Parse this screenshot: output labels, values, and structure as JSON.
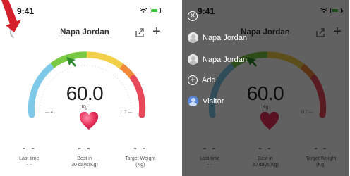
{
  "status_bar": {
    "time": "9:41"
  },
  "header": {
    "user_name": "Napa Jordan"
  },
  "gauge": {
    "weight": "60.0",
    "unit": "Kg",
    "tick_left": "41",
    "tick_right": "117"
  },
  "stats": [
    {
      "value": "- -",
      "label": "Last time",
      "sub": "- -"
    },
    {
      "value": "- -",
      "label": "Best in",
      "sub": "30 days(Kg)"
    },
    {
      "value": "- -",
      "label": "Target Weight",
      "sub": "(Kg)"
    }
  ],
  "menu": {
    "items": [
      {
        "label": "Napa Jordan",
        "type": "user"
      },
      {
        "label": "Napa Jordan",
        "type": "user"
      },
      {
        "label": "Add",
        "type": "add"
      },
      {
        "label": "Visitor",
        "type": "visitor"
      }
    ]
  },
  "colors": {
    "gauge_blue": "#7ec8e8",
    "gauge_green": "#7ac943",
    "gauge_yellow": "#f2d04a",
    "gauge_orange": "#f08a3a",
    "gauge_red": "#e8495a",
    "heart": "#e8305a",
    "annotation_red": "#d4202a"
  },
  "icons": [
    "avatar-icon",
    "share-icon",
    "plus-icon",
    "heart-icon",
    "close-icon",
    "user-avatar-icon",
    "add-circle-icon",
    "visitor-icon",
    "battery-icon",
    "wifi-icon",
    "signal-icon"
  ]
}
